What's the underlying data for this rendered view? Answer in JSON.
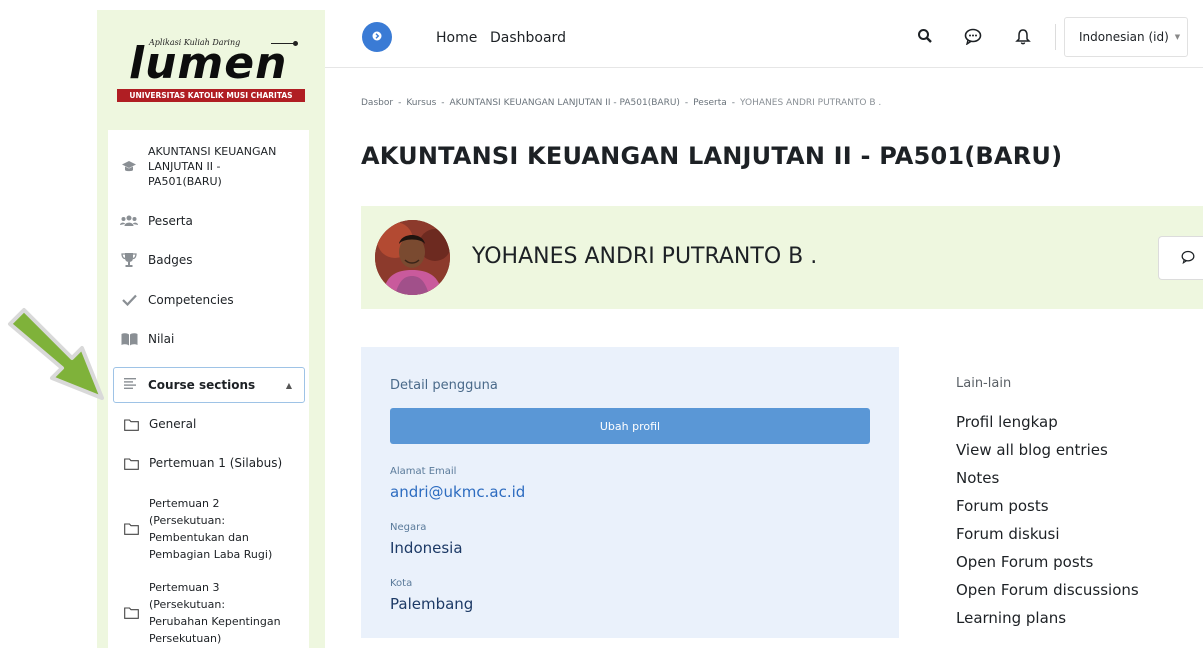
{
  "logo": {
    "tagline": "Aplikasi Kuliah Daring",
    "wordmark": "lumen",
    "institution": "UNIVERSITAS KATOLIK MUSI CHARITAS"
  },
  "sidebar": {
    "course_item": "AKUNTANSI KEUANGAN LANJUTAN II - PA501(BARU)",
    "items": [
      {
        "label": "Peserta",
        "icon": "users-icon"
      },
      {
        "label": "Badges",
        "icon": "trophy-icon"
      },
      {
        "label": "Competencies",
        "icon": "check-icon"
      },
      {
        "label": "Nilai",
        "icon": "book-icon"
      }
    ],
    "sections_label": "Course sections",
    "sections": [
      {
        "label": "General"
      },
      {
        "label": "Pertemuan 1 (Silabus)"
      },
      {
        "label": "Pertemuan 2\n(Persekutuan:\nPembentukan dan\nPembagian Laba Rugi)"
      },
      {
        "label": "Pertemuan 3\n(Persekutuan:\nPerubahan Kepentingan\nPersekutuan)"
      }
    ]
  },
  "header": {
    "home": "Home",
    "dashboard": "Dashboard",
    "language": "Indonesian (id)"
  },
  "breadcrumb": [
    "Dasbor",
    "Kursus",
    "AKUNTANSI KEUANGAN LANJUTAN II - PA501(BARU)",
    "Peserta",
    "YOHANES ANDRI PUTRANTO B ."
  ],
  "page_title": "AKUNTANSI KEUANGAN LANJUTAN II - PA501(BARU)",
  "profile": {
    "name": "YOHANES ANDRI PUTRANTO B ."
  },
  "details": {
    "heading": "Detail pengguna",
    "edit_button": "Ubah profil",
    "email_label": "Alamat Email",
    "email_value": "andri@ukmc.ac.id",
    "country_label": "Negara",
    "country_value": "Indonesia",
    "city_label": "Kota",
    "city_value": "Palembang"
  },
  "misc": {
    "heading": "Lain-lain",
    "links": [
      "Profil lengkap",
      "View all blog entries",
      "Notes",
      "Forum posts",
      "Forum diskusi",
      "Open Forum posts",
      "Open Forum discussions",
      "Learning plans"
    ]
  },
  "colors": {
    "sidebar_bg": "#eef7df",
    "accent_blue": "#3a7bd5",
    "button_blue": "#5a97d6",
    "card_bg": "#eaf1fb",
    "arrow_green": "#7fb23a",
    "logo_red": "#b01e23"
  }
}
